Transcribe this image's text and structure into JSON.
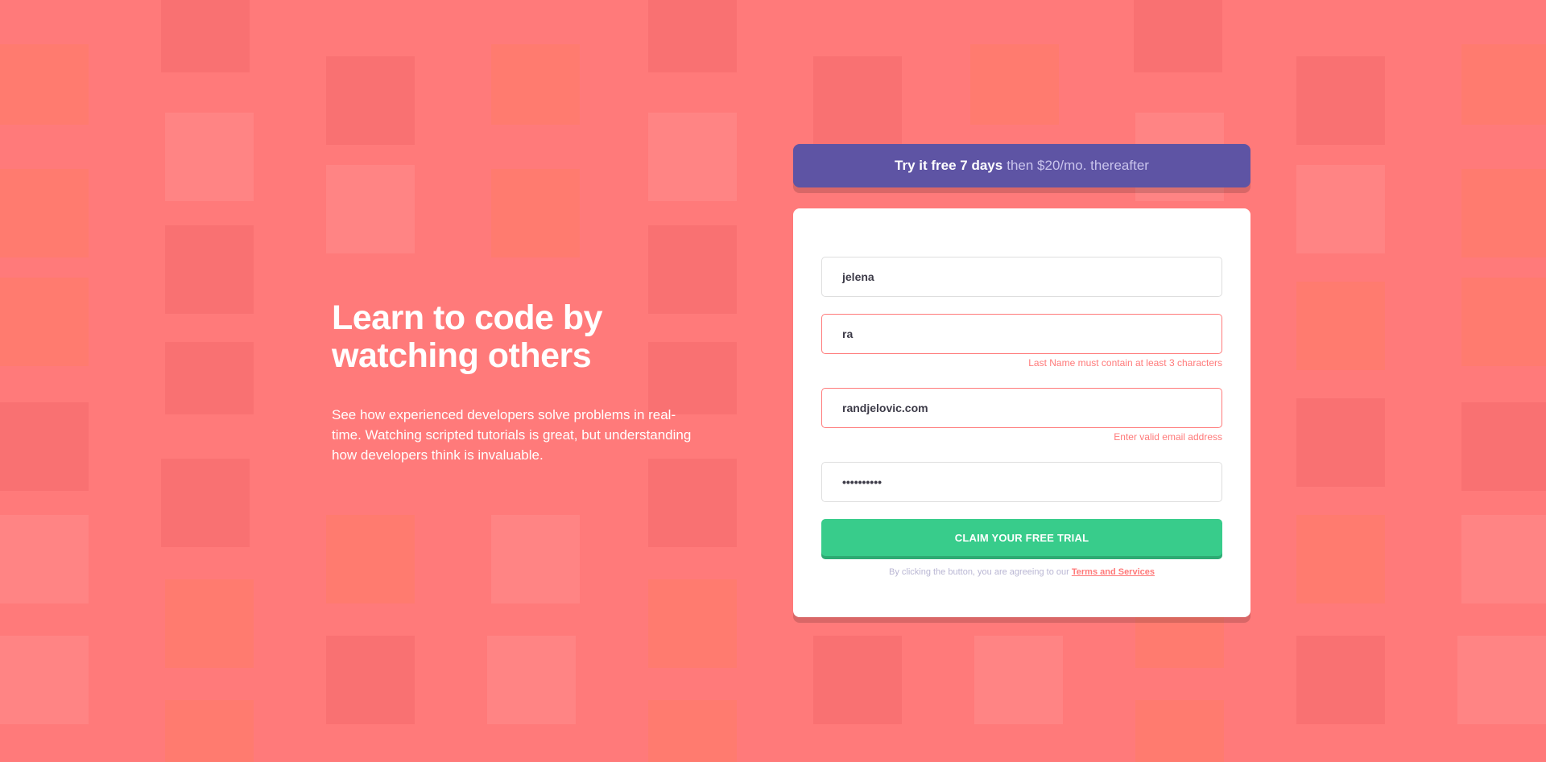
{
  "hero": {
    "title_line1": "Learn to code by",
    "title_line2": "watching others",
    "description": "See how experienced developers solve problems in real-time. Watching scripted tutorials is great, but understanding how developers think is invaluable."
  },
  "banner": {
    "strong_text": "Try it free 7 days",
    "light_text": "then $20/mo. thereafter"
  },
  "form": {
    "first_name": {
      "value": "jelena"
    },
    "last_name": {
      "value": "ra",
      "error": "Last Name must contain at least 3 characters"
    },
    "email": {
      "value": "randjelovic.com",
      "error": "Enter valid email address"
    },
    "password": {
      "value": "••••••••••"
    },
    "submit_label": "CLAIM YOUR FREE TRIAL",
    "terms_prefix": "By clicking the button, you are agreeing to our",
    "terms_link": "Terms and Services"
  },
  "colors": {
    "background": "#ff7a7a",
    "banner": "#5e54a4",
    "button": "#38cc8b",
    "error": "#ff7a7a"
  },
  "icons": [
    "browser-icon",
    "toolbox-icon",
    "headset-icon",
    "cloud-network-icon",
    "thumbs-up-icon",
    "chart-icon",
    "chat-icon",
    "rocket-icon",
    "cart-icon",
    "globe-gear-icon",
    "life-buoy-icon",
    "calendar-icon",
    "key-icon",
    "lightbulb-icon",
    "lock-icon",
    "folder-gear-icon",
    "magnifier-icon"
  ]
}
